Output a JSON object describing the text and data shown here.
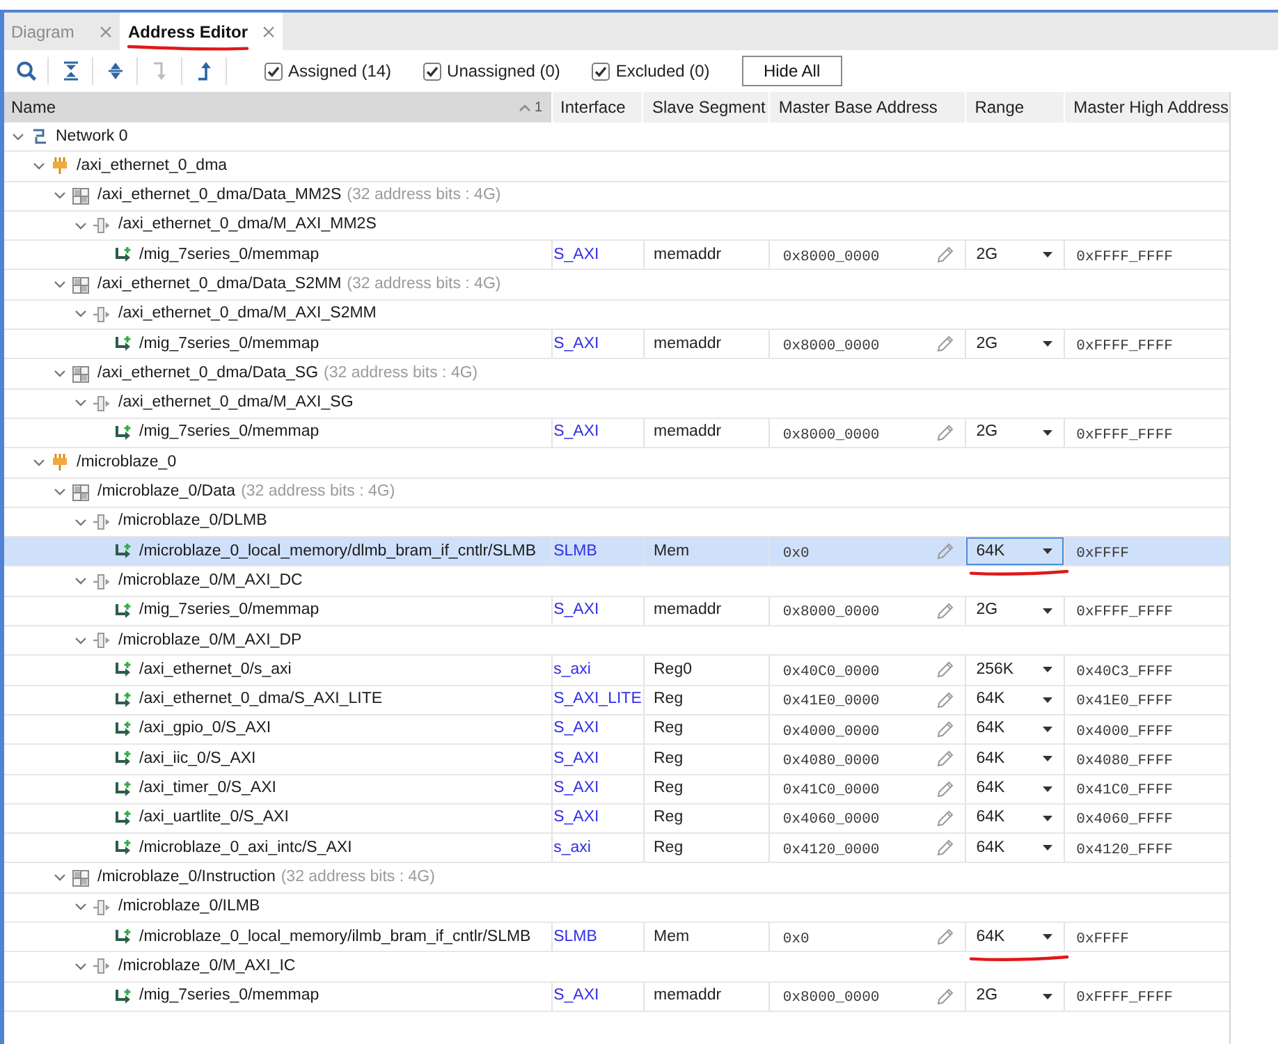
{
  "tabs": [
    {
      "label": "Diagram",
      "selected": false,
      "underlined": false
    },
    {
      "label": "Address Editor",
      "selected": true,
      "underlined": true
    }
  ],
  "toolbar": {
    "tools": [
      {
        "kind": "search",
        "disabled": false
      },
      {
        "kind": "collapse",
        "disabled": false
      },
      {
        "kind": "expand",
        "disabled": false
      },
      {
        "kind": "bent_arrow",
        "disabled": true
      },
      {
        "kind": "up_arrow",
        "disabled": false
      }
    ],
    "filters": [
      {
        "label": "Assigned (14)",
        "checked": true
      },
      {
        "label": "Unassigned (0)",
        "checked": true
      },
      {
        "label": "Excluded (0)",
        "checked": true
      }
    ],
    "hide_button": "Hide All"
  },
  "table": {
    "columns": [
      {
        "label": "Name",
        "sorted": true,
        "sort_rank": "1"
      },
      {
        "label": "Interface",
        "sorted": false
      },
      {
        "label": "Slave Segment",
        "sorted": false
      },
      {
        "label": "Master Base Address",
        "sorted": false
      },
      {
        "label": "Range",
        "sorted": false
      },
      {
        "label": "Master High Address",
        "sorted": false
      }
    ],
    "tree": [
      {
        "kind": "network",
        "name": "Network 0",
        "expanded": true,
        "selected": false,
        "children": [
          {
            "kind": "processor",
            "name": "/axi_ethernet_0_dma",
            "expanded": true,
            "selected": false,
            "children": [
              {
                "kind": "address_space",
                "name": "/axi_ethernet_0_dma/Data_MM2S",
                "detail": "(32 address bits : 4G)",
                "expanded": true,
                "selected": false,
                "children": [
                  {
                    "kind": "interface",
                    "name": "/axi_ethernet_0_dma/M_AXI_MM2S",
                    "expanded": true,
                    "selected": false,
                    "children": [
                      {
                        "kind": "segment",
                        "name": "/mig_7series_0/memmap",
                        "interface": "S_AXI",
                        "slave_segment": "memaddr",
                        "base_address": "0x8000_0000",
                        "range": "2G",
                        "high_address": "0xFFFF_FFFF",
                        "selected": false,
                        "underlined": false
                      }
                    ]
                  }
                ]
              },
              {
                "kind": "address_space",
                "name": "/axi_ethernet_0_dma/Data_S2MM",
                "detail": "(32 address bits : 4G)",
                "expanded": true,
                "selected": false,
                "children": [
                  {
                    "kind": "interface",
                    "name": "/axi_ethernet_0_dma/M_AXI_S2MM",
                    "expanded": true,
                    "selected": false,
                    "children": [
                      {
                        "kind": "segment",
                        "name": "/mig_7series_0/memmap",
                        "interface": "S_AXI",
                        "slave_segment": "memaddr",
                        "base_address": "0x8000_0000",
                        "range": "2G",
                        "high_address": "0xFFFF_FFFF",
                        "selected": false,
                        "underlined": false
                      }
                    ]
                  }
                ]
              },
              {
                "kind": "address_space",
                "name": "/axi_ethernet_0_dma/Data_SG",
                "detail": "(32 address bits : 4G)",
                "expanded": true,
                "selected": false,
                "children": [
                  {
                    "kind": "interface",
                    "name": "/axi_ethernet_0_dma/M_AXI_SG",
                    "expanded": true,
                    "selected": false,
                    "children": [
                      {
                        "kind": "segment",
                        "name": "/mig_7series_0/memmap",
                        "interface": "S_AXI",
                        "slave_segment": "memaddr",
                        "base_address": "0x8000_0000",
                        "range": "2G",
                        "high_address": "0xFFFF_FFFF",
                        "selected": false,
                        "underlined": false
                      }
                    ]
                  }
                ]
              }
            ]
          },
          {
            "kind": "processor",
            "name": "/microblaze_0",
            "expanded": true,
            "selected": false,
            "children": [
              {
                "kind": "address_space",
                "name": "/microblaze_0/Data",
                "detail": "(32 address bits : 4G)",
                "expanded": true,
                "selected": false,
                "children": [
                  {
                    "kind": "interface",
                    "name": "/microblaze_0/DLMB",
                    "expanded": true,
                    "selected": false,
                    "children": [
                      {
                        "kind": "segment",
                        "name": "/microblaze_0_local_memory/dlmb_bram_if_cntlr/SLMB",
                        "interface": "SLMB",
                        "slave_segment": "Mem",
                        "base_address": "0x0",
                        "range": "64K",
                        "high_address": "0xFFFF",
                        "selected": true,
                        "underlined": true
                      }
                    ]
                  },
                  {
                    "kind": "interface",
                    "name": "/microblaze_0/M_AXI_DC",
                    "expanded": true,
                    "selected": false,
                    "children": [
                      {
                        "kind": "segment",
                        "name": "/mig_7series_0/memmap",
                        "interface": "S_AXI",
                        "slave_segment": "memaddr",
                        "base_address": "0x8000_0000",
                        "range": "2G",
                        "high_address": "0xFFFF_FFFF",
                        "selected": false,
                        "underlined": false
                      }
                    ]
                  },
                  {
                    "kind": "interface",
                    "name": "/microblaze_0/M_AXI_DP",
                    "expanded": true,
                    "selected": false,
                    "children": [
                      {
                        "kind": "segment",
                        "name": "/axi_ethernet_0/s_axi",
                        "interface": "s_axi",
                        "slave_segment": "Reg0",
                        "base_address": "0x40C0_0000",
                        "range": "256K",
                        "high_address": "0x40C3_FFFF",
                        "selected": false,
                        "underlined": false
                      },
                      {
                        "kind": "segment",
                        "name": "/axi_ethernet_0_dma/S_AXI_LITE",
                        "interface": "S_AXI_LITE",
                        "slave_segment": "Reg",
                        "base_address": "0x41E0_0000",
                        "range": "64K",
                        "high_address": "0x41E0_FFFF",
                        "selected": false,
                        "underlined": false
                      },
                      {
                        "kind": "segment",
                        "name": "/axi_gpio_0/S_AXI",
                        "interface": "S_AXI",
                        "slave_segment": "Reg",
                        "base_address": "0x4000_0000",
                        "range": "64K",
                        "high_address": "0x4000_FFFF",
                        "selected": false,
                        "underlined": false
                      },
                      {
                        "kind": "segment",
                        "name": "/axi_iic_0/S_AXI",
                        "interface": "S_AXI",
                        "slave_segment": "Reg",
                        "base_address": "0x4080_0000",
                        "range": "64K",
                        "high_address": "0x4080_FFFF",
                        "selected": false,
                        "underlined": false
                      },
                      {
                        "kind": "segment",
                        "name": "/axi_timer_0/S_AXI",
                        "interface": "S_AXI",
                        "slave_segment": "Reg",
                        "base_address": "0x41C0_0000",
                        "range": "64K",
                        "high_address": "0x41C0_FFFF",
                        "selected": false,
                        "underlined": false
                      },
                      {
                        "kind": "segment",
                        "name": "/axi_uartlite_0/S_AXI",
                        "interface": "S_AXI",
                        "slave_segment": "Reg",
                        "base_address": "0x4060_0000",
                        "range": "64K",
                        "high_address": "0x4060_FFFF",
                        "selected": false,
                        "underlined": false
                      },
                      {
                        "kind": "segment",
                        "name": "/microblaze_0_axi_intc/S_AXI",
                        "interface": "s_axi",
                        "slave_segment": "Reg",
                        "base_address": "0x4120_0000",
                        "range": "64K",
                        "high_address": "0x4120_FFFF",
                        "selected": false,
                        "underlined": false
                      }
                    ]
                  }
                ]
              },
              {
                "kind": "address_space",
                "name": "/microblaze_0/Instruction",
                "detail": "(32 address bits : 4G)",
                "expanded": true,
                "selected": false,
                "children": [
                  {
                    "kind": "interface",
                    "name": "/microblaze_0/ILMB",
                    "expanded": true,
                    "selected": false,
                    "children": [
                      {
                        "kind": "segment",
                        "name": "/microblaze_0_local_memory/ilmb_bram_if_cntlr/SLMB",
                        "interface": "SLMB",
                        "slave_segment": "Mem",
                        "base_address": "0x0",
                        "range": "64K",
                        "high_address": "0xFFFF",
                        "selected": false,
                        "underlined": true
                      }
                    ]
                  },
                  {
                    "kind": "interface",
                    "name": "/microblaze_0/M_AXI_IC",
                    "expanded": true,
                    "selected": false,
                    "children": [
                      {
                        "kind": "segment",
                        "name": "/mig_7series_0/memmap",
                        "interface": "S_AXI",
                        "slave_segment": "memaddr",
                        "base_address": "0x8000_0000",
                        "range": "2G",
                        "high_address": "0xFFFF_FFFF",
                        "selected": false,
                        "underlined": false
                      }
                    ]
                  }
                ]
              }
            ]
          }
        ]
      }
    ]
  }
}
